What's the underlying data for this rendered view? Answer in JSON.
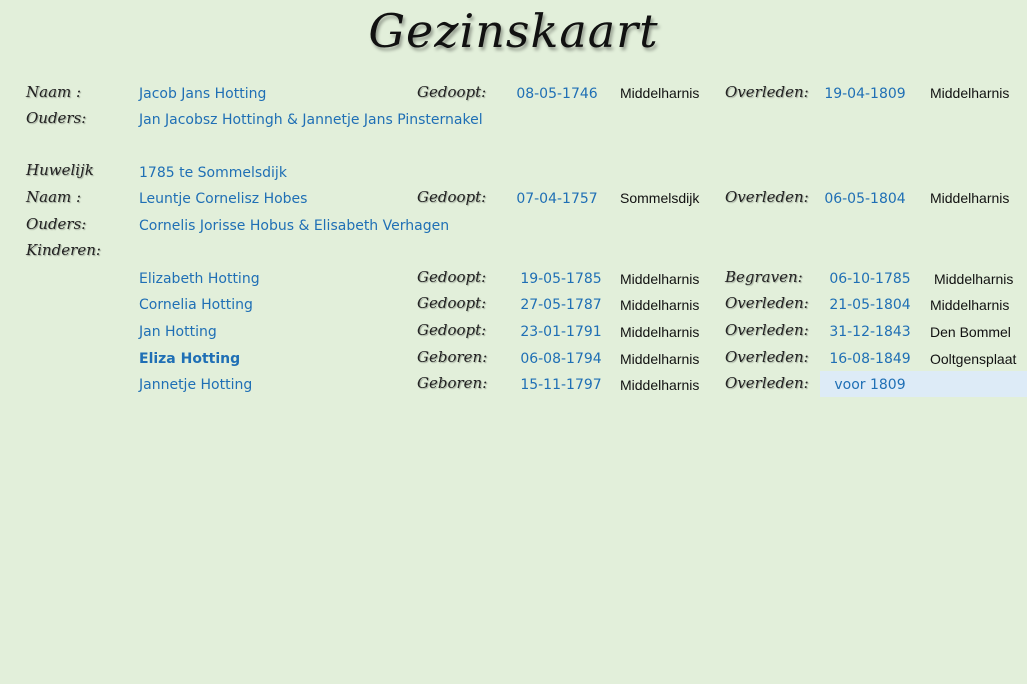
{
  "title": "Gezinskaart",
  "labels": {
    "naam": "Naam :",
    "ouders": "Ouders:",
    "huwelijk": "Huwelijk",
    "kinderen": "Kinderen:",
    "gedoopt": "Gedoopt:",
    "geboren": "Geboren:",
    "overleden": "Overleden:",
    "begraven": "Begraven:"
  },
  "husband": {
    "name": "Jacob Jans Hotting",
    "event_label": "Gedoopt:",
    "date": "08-05-1746",
    "place": "Middelharnis",
    "death_label": "Overleden:",
    "death_date": "19-04-1809",
    "death_place": "Middelharnis",
    "parents": "Jan Jacobsz Hottingh & Jannetje Jans Pinsternakel"
  },
  "marriage": "1785 te Sommelsdijk",
  "wife": {
    "name": "Leuntje Cornelisz Hobes",
    "event_label": "Gedoopt:",
    "date": "07-04-1757",
    "place": "Sommelsdijk",
    "death_label": "Overleden:",
    "death_date": "06-05-1804",
    "death_place": "Middelharnis",
    "parents": "Cornelis Jorisse Hobus & Elisabeth Verhagen"
  },
  "children": [
    {
      "name": "Elizabeth Hotting",
      "event_label": "Gedoopt:",
      "date": "19-05-1785",
      "place": "Middelharnis",
      "death_label": "Begraven:",
      "death_date": "06-10-1785",
      "death_place": "Middelharnis"
    },
    {
      "name": "Cornelia Hotting",
      "event_label": "Gedoopt:",
      "date": "27-05-1787",
      "place": "Middelharnis",
      "death_label": "Overleden:",
      "death_date": "21-05-1804",
      "death_place": "Middelharnis"
    },
    {
      "name": "Jan Hotting",
      "event_label": "Gedoopt:",
      "date": "23-01-1791",
      "place": "Middelharnis",
      "death_label": "Overleden:",
      "death_date": "31-12-1843",
      "death_place": "Den Bommel"
    },
    {
      "name": "Eliza Hotting",
      "event_label": "Geboren:",
      "date": "06-08-1794",
      "place": "Middelharnis",
      "death_label": "Overleden:",
      "death_date": "16-08-1849",
      "death_place": "Ooltgensplaat"
    },
    {
      "name": "Jannetje Hotting",
      "event_label": "Geboren:",
      "date": "15-11-1797",
      "place": "Middelharnis",
      "death_label": "Overleden:",
      "death_date": "voor 1809",
      "death_place": ""
    }
  ],
  "colors": {
    "background": "#e2efda",
    "value_blue": "#1f6fb5",
    "highlight_cell": "#ddebf7"
  }
}
